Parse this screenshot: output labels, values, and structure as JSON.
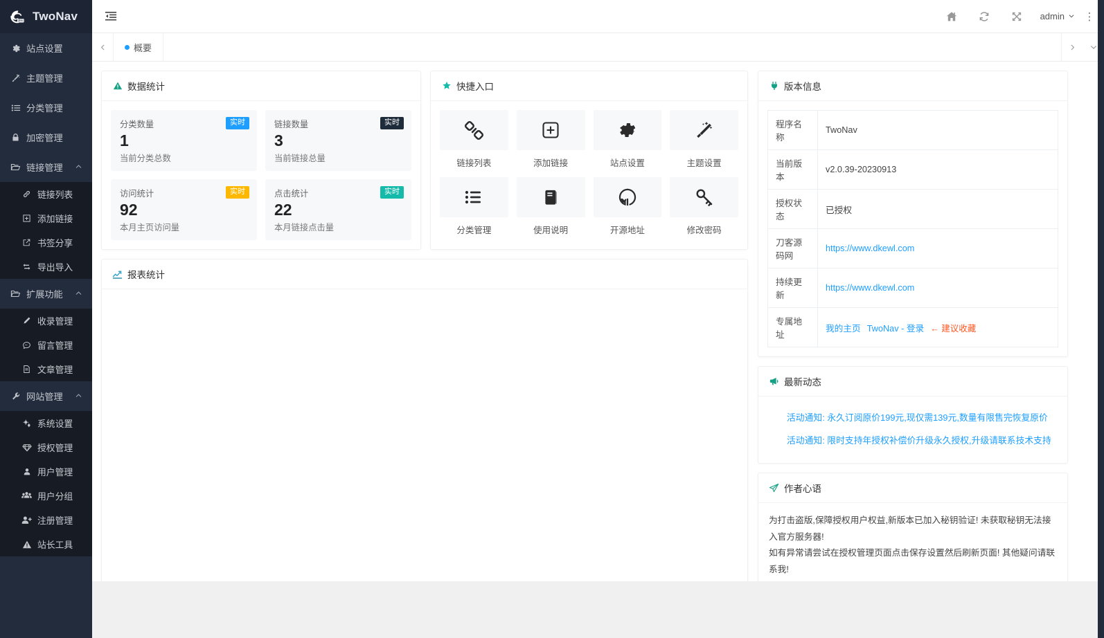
{
  "brand": {
    "name": "TwoNav",
    "logo_icon": "cloud-e-logo"
  },
  "sidebar": {
    "items": [
      {
        "label": "站点设置",
        "icon": "gear-icon",
        "type": "link"
      },
      {
        "label": "主题管理",
        "icon": "magic-wand-icon",
        "type": "link"
      },
      {
        "label": "分类管理",
        "icon": "list-icon",
        "type": "link"
      },
      {
        "label": "加密管理",
        "icon": "lock-icon",
        "type": "link"
      },
      {
        "label": "链接管理",
        "icon": "folder-icon",
        "type": "group",
        "expanded": true,
        "children": [
          {
            "label": "链接列表",
            "icon": "link-icon"
          },
          {
            "label": "添加链接",
            "icon": "plus-square-icon"
          },
          {
            "label": "书签分享",
            "icon": "external-link-icon"
          },
          {
            "label": "导出导入",
            "icon": "transfer-icon"
          }
        ]
      },
      {
        "label": "扩展功能",
        "icon": "folder-icon",
        "type": "group",
        "expanded": true,
        "children": [
          {
            "label": "收录管理",
            "icon": "pencil-icon"
          },
          {
            "label": "留言管理",
            "icon": "comment-icon"
          },
          {
            "label": "文章管理",
            "icon": "file-icon"
          }
        ]
      },
      {
        "label": "网站管理",
        "icon": "wrench-icon",
        "type": "group",
        "expanded": true,
        "children": [
          {
            "label": "系统设置",
            "icon": "cogs-icon"
          },
          {
            "label": "授权管理",
            "icon": "diamond-icon"
          },
          {
            "label": "用户管理",
            "icon": "user-icon"
          },
          {
            "label": "用户分组",
            "icon": "users-icon"
          },
          {
            "label": "注册管理",
            "icon": "user-plus-icon"
          },
          {
            "label": "站长工具",
            "icon": "warning-icon"
          }
        ]
      }
    ]
  },
  "header": {
    "menu_toggle_icon": "menu-fold-icon",
    "actions": [
      {
        "name": "home",
        "icon": "home-icon"
      },
      {
        "name": "refresh",
        "icon": "refresh-icon"
      },
      {
        "name": "fullscreen",
        "icon": "expand-icon"
      }
    ],
    "user": {
      "name": "admin",
      "caret_icon": "chevron-down-icon"
    },
    "more_icon": "vertical-dots-icon"
  },
  "tabbar": {
    "prev_icon": "chevron-left-icon",
    "next_icon": "chevron-right-icon",
    "dropdown_icon": "chevron-down-icon",
    "tabs": [
      {
        "label": "概要",
        "active": true
      }
    ]
  },
  "stats_card": {
    "title": "数据统计",
    "icon": "warning-triangle-icon",
    "items": [
      {
        "label": "分类数量",
        "value": "1",
        "sub": "当前分类总数",
        "badge": "实时",
        "badge_color": "#1e9fff"
      },
      {
        "label": "链接数量",
        "value": "3",
        "sub": "当前链接总量",
        "badge": "实时",
        "badge_color": "#1e2b3b"
      },
      {
        "label": "访问统计",
        "value": "92",
        "sub": "本月主页访问量",
        "badge": "实时",
        "badge_color": "#ffb800"
      },
      {
        "label": "点击统计",
        "value": "22",
        "sub": "本月链接点击量",
        "badge": "实时",
        "badge_color": "#16baaa"
      }
    ]
  },
  "quick_card": {
    "title": "快捷入口",
    "icon": "star-icon",
    "items": [
      {
        "label": "链接列表",
        "icon": "chain-icon"
      },
      {
        "label": "添加链接",
        "icon": "plus-square-icon"
      },
      {
        "label": "站点设置",
        "icon": "gear-icon"
      },
      {
        "label": "主题设置",
        "icon": "magic-wand-icon"
      },
      {
        "label": "分类管理",
        "icon": "list-ul-icon"
      },
      {
        "label": "使用说明",
        "icon": "book-icon"
      },
      {
        "label": "开源地址",
        "icon": "github-icon"
      },
      {
        "label": "修改密码",
        "icon": "key-icon"
      }
    ]
  },
  "report_card": {
    "title": "报表统计",
    "icon": "chart-line-icon"
  },
  "version_card": {
    "title": "版本信息",
    "icon": "plug-icon",
    "rows": [
      {
        "key": "程序名称",
        "value": "TwoNav",
        "type": "text"
      },
      {
        "key": "当前版本",
        "value": "v2.0.39-20230913",
        "type": "text"
      },
      {
        "key": "授权状态",
        "value": "已授权",
        "type": "text"
      },
      {
        "key": "刀客源码网",
        "value": "https://www.dkewl.com",
        "type": "link"
      },
      {
        "key": "持续更新",
        "value": "https://www.dkewl.com",
        "type": "link"
      }
    ],
    "address_row": {
      "key": "专属地址",
      "links": [
        "我的主页",
        "TwoNav - 登录"
      ],
      "tip": "← 建议收藏"
    }
  },
  "news_card": {
    "title": "最新动态",
    "icon": "megaphone-icon",
    "items": [
      "活动通知: 永久订阅原价199元,现仅需139元,数量有限售完恢复原价",
      "活动通知: 限时支持年授权补偿价升级永久授权,升级请联系技术支持"
    ]
  },
  "note_card": {
    "title": "作者心语",
    "icon": "paper-plane-icon",
    "paragraphs": [
      "为打击盗版,保障授权用户权益,新版本已加入秘钥验证! 未获取秘钥无法接入官方服务器!",
      "如有异常请尝试在授权管理页面点击保存设置然后刷新页面! 其他疑问请联系我!"
    ]
  }
}
